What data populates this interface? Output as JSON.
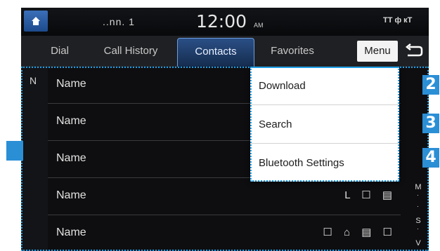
{
  "status_bar": {
    "signal": "..nn.  1",
    "clock": "12:00",
    "ampm": "AM",
    "icons": "TT ф кТ"
  },
  "tabs": [
    {
      "label": "Dial"
    },
    {
      "label": "Call History"
    },
    {
      "label": "Contacts"
    },
    {
      "label": "Favorites"
    }
  ],
  "menu_label": "Menu",
  "index_letter": "N",
  "contacts": [
    {
      "name": "Name",
      "icons": ""
    },
    {
      "name": "Name",
      "icons": ""
    },
    {
      "name": "Name",
      "icons": ""
    },
    {
      "name": "Name",
      "icons": "L ☐ ▤"
    },
    {
      "name": "Name",
      "icons": "☐ ⌂ ▤ ☐"
    }
  ],
  "alphabet": [
    "M",
    "˙",
    "˙",
    "S",
    "˙",
    "V"
  ],
  "dropdown": {
    "items": [
      "Download",
      "Search",
      "Bluetooth Settings"
    ]
  },
  "markers": [
    "2",
    "3",
    "4"
  ],
  "colors": {
    "accent": "#2b8fd6",
    "tab_active": "#2a4f86",
    "background": "#0e0e10"
  }
}
